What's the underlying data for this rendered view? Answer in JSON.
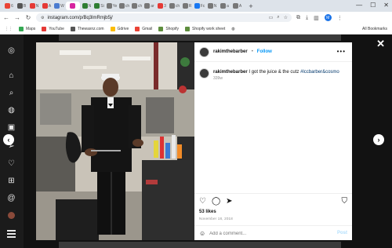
{
  "browser": {
    "tabs": [
      {
        "label": "6",
        "color": "#e94335"
      },
      {
        "label": "B",
        "color": "#555555"
      },
      {
        "label": "N",
        "color": "#e53935"
      },
      {
        "label": "A",
        "color": "#e53935"
      },
      {
        "label": "W",
        "color": "#4a7bd0"
      },
      {
        "label": "",
        "color": "#d6249f",
        "active": true
      },
      {
        "label": "N",
        "color": "#2e7d32"
      },
      {
        "label": "Si",
        "color": "#2e7d32"
      },
      {
        "label": "Ye",
        "color": "#777777"
      },
      {
        "label": "ch",
        "color": "#777777"
      },
      {
        "label": "ch",
        "color": "#777777"
      },
      {
        "label": "ar",
        "color": "#777777"
      },
      {
        "label": "3",
        "color": "#e53935"
      },
      {
        "label": "ch",
        "color": "#777777"
      },
      {
        "label": "R",
        "color": "#777777"
      },
      {
        "label": "Fc",
        "color": "#1877f2"
      },
      {
        "label": "N",
        "color": "#777777"
      },
      {
        "label": "a",
        "color": "#777777"
      },
      {
        "label": "A",
        "color": "#777777"
      }
    ],
    "new_tab": "+",
    "url": "instagram.com/p/Bq3lmRmjb5j/",
    "bookmarks": [
      {
        "label": "Maps",
        "color": "#34a853"
      },
      {
        "label": "YouTube",
        "color": "#e53935"
      },
      {
        "label": "Thewaxnz.com",
        "color": "#555555"
      },
      {
        "label": "Gdrive",
        "color": "#fbbc04"
      },
      {
        "label": "Gmail",
        "color": "#ea4335"
      },
      {
        "label": "Shopify",
        "color": "#5e8e3e"
      },
      {
        "label": "Shopify work sheet",
        "color": "#5e8e3e"
      }
    ],
    "all_bookmarks": "All Bookmarks",
    "profile_initial": "M"
  },
  "post": {
    "username": "rakimthebarber",
    "follow": "Follow",
    "separator": "•",
    "more": "•••",
    "caption_user": "rakimthebarber",
    "caption_text": " I got the juice & the cutz ",
    "caption_hashtag": "#lccbarber",
    "caption_mention": "&cosmo",
    "caption_time": "339w",
    "likes": "53 likes",
    "date": "November 18, 2018",
    "comment_placeholder": "Add a comment...",
    "post_button": "Post"
  },
  "icons": {
    "close": "✕",
    "prev": "‹",
    "next": "›",
    "like": "♡",
    "comment": "◯",
    "share": "➤",
    "save": "⛉",
    "emoji": "☺"
  },
  "colors": {
    "follow_blue": "#0095f6",
    "hashtag": "#00376b",
    "overlay": "#121212"
  }
}
